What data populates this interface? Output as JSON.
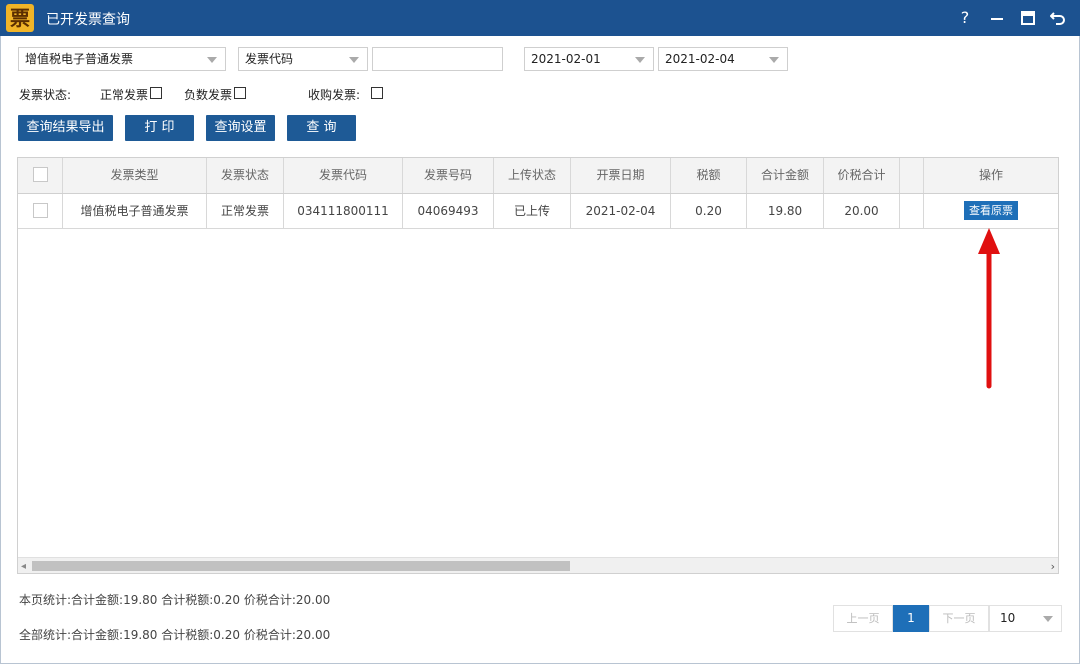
{
  "window": {
    "title": "已开发票查询",
    "logo_char": "票",
    "help_label": "?"
  },
  "filters": {
    "invoice_type": "增值税电子普通发票",
    "search_field": "发票代码",
    "search_value": "",
    "date_from": "2021-02-01",
    "date_to": "2021-02-04",
    "status_label": "发票状态:",
    "normal_label": "正常发票",
    "negative_label": "负数发票",
    "purchase_label": "收购发票:"
  },
  "buttons": {
    "export": "查询结果导出",
    "print": "打 印",
    "settings": "查询设置",
    "query": "查 询"
  },
  "table": {
    "headers": [
      "发票类型",
      "发票状态",
      "发票代码",
      "发票号码",
      "上传状态",
      "开票日期",
      "税额",
      "合计金额",
      "价税合计",
      "",
      "操作"
    ],
    "rows": [
      {
        "type": "增值税电子普通发票",
        "status": "正常发票",
        "code": "034111800111",
        "number": "04069493",
        "upload": "已上传",
        "date": "2021-02-04",
        "tax": "0.20",
        "amount": "19.80",
        "total": "20.00",
        "action": "查看原票"
      }
    ]
  },
  "stats": {
    "page": "本页统计:合计金额:19.80 合计税额:0.20 价税合计:20.00",
    "all": "全部统计:合计金额:19.80 合计税额:0.20 价税合计:20.00"
  },
  "pager": {
    "prev": "上一页",
    "current": "1",
    "next": "下一页",
    "page_size": "10"
  },
  "colors": {
    "titlebar": "#1c5290",
    "button": "#1e5a96",
    "annotation_arrow": "#e01010"
  }
}
